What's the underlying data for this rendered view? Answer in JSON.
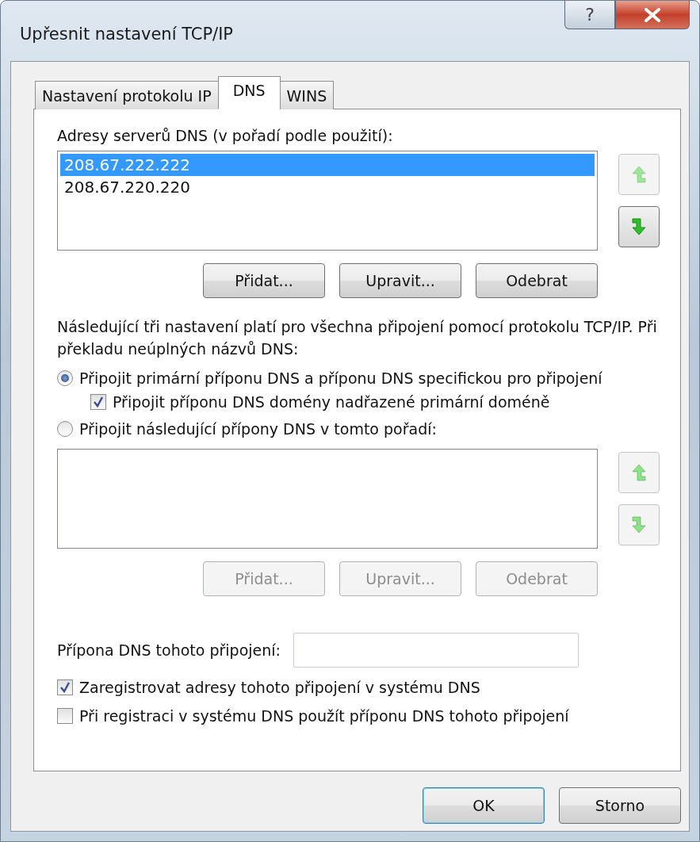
{
  "window": {
    "title": "Upřesnit nastavení TCP/IP",
    "help_button": "?"
  },
  "tabs": [
    {
      "label": "Nastavení protokolu IP",
      "selected": false
    },
    {
      "label": "DNS",
      "selected": true
    },
    {
      "label": "WINS",
      "selected": false
    }
  ],
  "dns_servers": {
    "label": "Adresy serverů DNS (v pořadí podle použití):",
    "items": [
      {
        "text": "208.67.222.222",
        "selected": true
      },
      {
        "text": "208.67.220.220",
        "selected": false
      }
    ],
    "move_up": {
      "disabled": true
    },
    "move_down": {
      "disabled": false
    },
    "buttons": [
      {
        "label": "Přidat...",
        "disabled": false
      },
      {
        "label": "Upravit...",
        "disabled": false
      },
      {
        "label": "Odebrat",
        "disabled": false
      }
    ]
  },
  "description": "Následující tři nastavení platí pro všechna připojení pomocí protokolu TCP/IP. Při překladu neúplných názvů DNS:",
  "radio_options": [
    {
      "label": "Připojit primární příponu DNS a příponu DNS specifickou pro připojení",
      "selected": true,
      "sub_checkbox": {
        "label": "Připojit příponu DNS domény nadřazené primární doméně",
        "checked": true
      }
    },
    {
      "label": "Připojit následující přípony DNS v tomto pořadí:",
      "selected": false
    }
  ],
  "suffix_list": {
    "move_up": {
      "disabled": true
    },
    "move_down": {
      "disabled": true
    },
    "buttons": [
      {
        "label": "Přidat...",
        "disabled": true
      },
      {
        "label": "Upravit...",
        "disabled": true
      },
      {
        "label": "Odebrat",
        "disabled": true
      }
    ]
  },
  "suffix_field": {
    "label": "Přípona DNS tohoto připojení:"
  },
  "checkboxes": [
    {
      "label": "Zaregistrovat adresy tohoto připojení v systému DNS",
      "checked": true
    },
    {
      "label": "Při registraci v systému DNS použít příponu DNS tohoto připojení",
      "checked": false
    }
  ],
  "dialog_buttons": [
    {
      "label": "OK",
      "default": true
    },
    {
      "label": "Storno",
      "default": false
    }
  ]
}
